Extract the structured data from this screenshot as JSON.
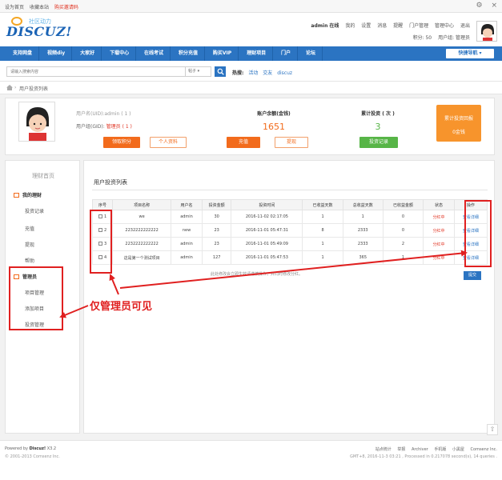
{
  "topbar": {
    "links": [
      "设为首页",
      "收藏本站",
      "购买邀请码"
    ],
    "win_icons": [
      "⚙",
      "×"
    ]
  },
  "header": {
    "logo_slogan": "社区动力",
    "logo_text": "DISCUZ!",
    "user_row1": [
      "admin 在线",
      "我的",
      "设置",
      "消息",
      "提醒",
      "门户管理",
      "管理中心",
      "退出"
    ],
    "user_row2": [
      "积分: 50",
      "用户组: 管理员"
    ]
  },
  "nav": {
    "items": [
      "支持网盘",
      "视频diy",
      "大家好",
      "下载中心",
      "在线考试",
      "积分充值",
      "购买VIP",
      "理财项目",
      "门户",
      "论坛"
    ],
    "quick": "快捷导航 ▾"
  },
  "search": {
    "placeholder": "请输入搜索内容",
    "scope": "帖子 ▾",
    "hot_label": "热搜:",
    "hot_words": [
      "活动",
      "交友",
      "discuz"
    ]
  },
  "breadcrumb": {
    "sep": "›",
    "text": "用户投资列表"
  },
  "profile": {
    "name": "用户名(UID):admin ( 1 )",
    "group_label": "用户组(GID):",
    "group_value": "管理员 ( 1 )",
    "btn_points": "领取积分",
    "btn_info": "个人资料",
    "acct_label": "账户余额(金钱)",
    "acct_value": "1651",
    "btn_recharge": "充值",
    "btn_withdraw": "提现",
    "invest_label": "累计投资 ( 次 )",
    "invest_value": "3",
    "btn_invest_record": "投资记录",
    "cta_line1": "累计投资回报",
    "cta_line2": "0金钱"
  },
  "sidebar": {
    "title": "理财首页",
    "section1": "我的理财",
    "items1": [
      "投资记录",
      "充值",
      "提现",
      "帮助"
    ],
    "section2": "管理员",
    "items2": [
      "项目管理",
      "添加项目",
      "投资管理"
    ]
  },
  "main": {
    "title": "用户投资列表",
    "columns": [
      "序号",
      "项目名称",
      "用户名",
      "投资金额",
      "投资时间",
      "已收益天数",
      "总收益天数",
      "已收益金额",
      "状态",
      "操作"
    ],
    "rows": [
      [
        "1",
        "we",
        "admin",
        "30",
        "2016-11-02 02:17:05",
        "1",
        "1",
        "0",
        "分红中",
        "查看详细"
      ],
      [
        "2",
        "2232222222222",
        "new",
        "23",
        "2016-11-01 05:47:31",
        "8",
        "2333",
        "0",
        "分红中",
        "查看详细"
      ],
      [
        "3",
        "2232222222222",
        "admin",
        "23",
        "2016-11-01 05:49:09",
        "1",
        "2333",
        "2",
        "分红中",
        "查看详细"
      ],
      [
        "4",
        "这是第一个测试项目",
        "admin",
        "127",
        "2016-11-01 05:47:53",
        "1",
        "365",
        "1",
        "分红中",
        "查看详细"
      ]
    ],
    "note": "此处修改会立即生效请谨慎操作，并同时修改分红。",
    "save": "提交"
  },
  "annotation": "仅管理员可见",
  "scroll_top": "⇧",
  "footer": {
    "powered_prefix": "Powered by",
    "powered_brand": "Discuz!",
    "powered_version": "X3.2",
    "copyright": "© 2001-2013 Comsenz Inc.",
    "links": [
      "站点统计",
      "举报",
      "Archiver",
      "手机版",
      "小黑屋",
      "Comsenz Inc."
    ],
    "gmt": "GMT+8, 2016-11-3 03:21 , Processed in 0.217078 second(s), 14 queries ."
  },
  "colors": {
    "nav_blue": "#2b74c2",
    "accent_orange": "#f26b1c",
    "accent_green": "#57b547",
    "annotation_red": "#e02020"
  }
}
